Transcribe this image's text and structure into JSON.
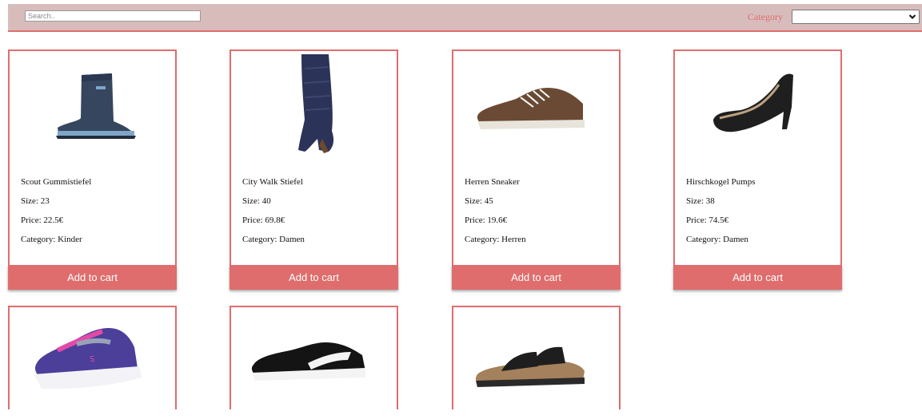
{
  "search": {
    "placeholder": "Search.."
  },
  "filter": {
    "label": "Category",
    "selected": ""
  },
  "card_labels": {
    "size_prefix": "Size: ",
    "price_prefix": "Price: ",
    "category_prefix": "Category: ",
    "add_to_cart": "Add to cart"
  },
  "products": [
    {
      "name": "Scout Gummistiefel",
      "size": "23",
      "price": "22.5€",
      "category": "Kinder",
      "icon": "rain-boot-icon"
    },
    {
      "name": "City Walk Stiefel",
      "size": "40",
      "price": "69.8€",
      "category": "Damen",
      "icon": "tall-boot-icon"
    },
    {
      "name": "Herren Sneaker",
      "size": "45",
      "price": "19.6€",
      "category": "Herren",
      "icon": "sneaker-icon"
    },
    {
      "name": "Hirschkogel Pumps",
      "size": "38",
      "price": "74.5€",
      "category": "Damen",
      "icon": "pump-icon"
    },
    {
      "icon": "kids-sneaker-icon"
    },
    {
      "icon": "puma-sneaker-icon"
    },
    {
      "icon": "sandal-icon"
    }
  ],
  "colors": {
    "accent": "#df6d6d",
    "topbar": "#d8bcbc"
  }
}
